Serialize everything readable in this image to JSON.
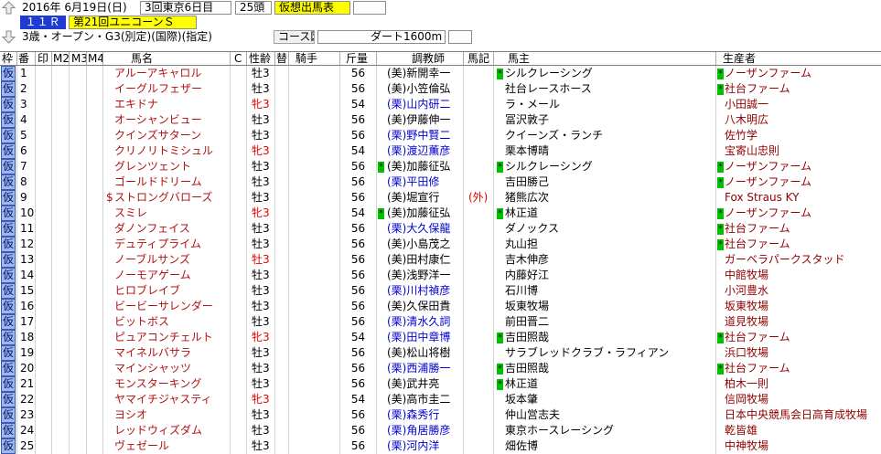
{
  "toolbar": {
    "date": "2016年 6月19日(日)",
    "meeting": "3回東京6日目",
    "runners": "25頭",
    "mode": "仮想出馬表",
    "race_number": "１１Ｒ",
    "race_name": "第21回ユニコーンＳ",
    "conditions": "3歳・オープン・G3(別定)(国際)(指定)",
    "course_map_button": "コース図",
    "course": "ダート1600m"
  },
  "icons": {
    "previous": "up-arrow-icon",
    "next": "down-arrow-icon"
  },
  "colors": {
    "text": "#000000",
    "horse_name": "#b01010",
    "female": "#e00000",
    "east_trainer": "#000000",
    "west_trainer": "#0000d0",
    "horse_mark": "#e00000",
    "breeder": "#900000",
    "marker": "#00c000",
    "waku_badge": "#9db8ec",
    "race_number_bg": "#1e3cd2",
    "highlight": "#ffff00"
  },
  "columns": [
    "枠",
    "番",
    "印",
    "M2",
    "M3",
    "M4",
    "馬名",
    "C",
    "性齢",
    "替",
    "騎手",
    "斤量",
    "調教師",
    "馬記",
    "馬主",
    "生産者"
  ],
  "rows": [
    {
      "waku": "仮",
      "no": "1",
      "name_prefix": "",
      "name": "アルーアキャロル",
      "sex_age": "牡3",
      "sex_red": false,
      "weight": "56",
      "trainer_mark": "",
      "trainer": "(美)新開幸一",
      "trainer_west": false,
      "horse_mark": "",
      "owner_mark": "*",
      "owner": "シルクレーシング",
      "breeder_mark": "*",
      "breeder": "ノーザンファーム"
    },
    {
      "waku": "仮",
      "no": "2",
      "name_prefix": "",
      "name": "イーグルフェザー",
      "sex_age": "牡3",
      "sex_red": false,
      "weight": "56",
      "trainer_mark": "",
      "trainer": "(美)小笠倫弘",
      "trainer_west": false,
      "horse_mark": "",
      "owner_mark": "",
      "owner": "社台レースホース",
      "breeder_mark": "*",
      "breeder": "社台ファーム"
    },
    {
      "waku": "仮",
      "no": "3",
      "name_prefix": "",
      "name": "エキドナ",
      "sex_age": "牝3",
      "sex_red": true,
      "weight": "54",
      "trainer_mark": "",
      "trainer": "(栗)山内研二",
      "trainer_west": true,
      "horse_mark": "",
      "owner_mark": "",
      "owner": "ラ・メール",
      "breeder_mark": "",
      "breeder": "小田誠一"
    },
    {
      "waku": "仮",
      "no": "4",
      "name_prefix": "",
      "name": "オーシャンビュー",
      "sex_age": "牡3",
      "sex_red": false,
      "weight": "56",
      "trainer_mark": "",
      "trainer": "(美)伊藤伸一",
      "trainer_west": false,
      "horse_mark": "",
      "owner_mark": "",
      "owner": "冨沢敦子",
      "breeder_mark": "",
      "breeder": "八木明広"
    },
    {
      "waku": "仮",
      "no": "5",
      "name_prefix": "",
      "name": "クインズサターン",
      "sex_age": "牡3",
      "sex_red": false,
      "weight": "56",
      "trainer_mark": "",
      "trainer": "(栗)野中賢二",
      "trainer_west": true,
      "horse_mark": "",
      "owner_mark": "",
      "owner": "クイーンズ・ランチ",
      "breeder_mark": "",
      "breeder": "佐竹学"
    },
    {
      "waku": "仮",
      "no": "6",
      "name_prefix": "",
      "name": "クリノリトミシュル",
      "sex_age": "牝3",
      "sex_red": true,
      "weight": "54",
      "trainer_mark": "",
      "trainer": "(栗)渡辺薫彦",
      "trainer_west": true,
      "horse_mark": "",
      "owner_mark": "",
      "owner": "栗本博晴",
      "breeder_mark": "",
      "breeder": "宝寄山忠則"
    },
    {
      "waku": "仮",
      "no": "7",
      "name_prefix": "",
      "name": "グレンツェント",
      "sex_age": "牡3",
      "sex_red": false,
      "weight": "56",
      "trainer_mark": "*",
      "trainer": "(美)加藤征弘",
      "trainer_west": false,
      "horse_mark": "",
      "owner_mark": "*",
      "owner": "シルクレーシング",
      "breeder_mark": "*",
      "breeder": "ノーザンファーム"
    },
    {
      "waku": "仮",
      "no": "8",
      "name_prefix": "",
      "name": "ゴールドドリーム",
      "sex_age": "牡3",
      "sex_red": false,
      "weight": "56",
      "trainer_mark": "",
      "trainer": "(栗)平田修",
      "trainer_west": true,
      "horse_mark": "",
      "owner_mark": "",
      "owner": "吉田勝己",
      "breeder_mark": "*",
      "breeder": "ノーザンファーム"
    },
    {
      "waku": "仮",
      "no": "9",
      "name_prefix": "$",
      "name": "ストロングバローズ",
      "sex_age": "牡3",
      "sex_red": false,
      "weight": "56",
      "trainer_mark": "",
      "trainer": "(美)堀宣行",
      "trainer_west": false,
      "horse_mark": "(外)",
      "owner_mark": "",
      "owner": "猪熊広次",
      "breeder_mark": "",
      "breeder": "Fox Straus KY"
    },
    {
      "waku": "仮",
      "no": "10",
      "name_prefix": "",
      "name": "スミレ",
      "sex_age": "牝3",
      "sex_red": true,
      "weight": "54",
      "trainer_mark": "*",
      "trainer": "(美)加藤征弘",
      "trainer_west": false,
      "horse_mark": "",
      "owner_mark": "*",
      "owner": "林正道",
      "breeder_mark": "*",
      "breeder": "ノーザンファーム"
    },
    {
      "waku": "仮",
      "no": "11",
      "name_prefix": "",
      "name": "ダノンフェイス",
      "sex_age": "牡3",
      "sex_red": false,
      "weight": "56",
      "trainer_mark": "",
      "trainer": "(栗)大久保龍",
      "trainer_west": true,
      "horse_mark": "",
      "owner_mark": "",
      "owner": "ダノックス",
      "breeder_mark": "*",
      "breeder": "社台ファーム"
    },
    {
      "waku": "仮",
      "no": "12",
      "name_prefix": "",
      "name": "デュティプライム",
      "sex_age": "牡3",
      "sex_red": false,
      "weight": "56",
      "trainer_mark": "",
      "trainer": "(美)小島茂之",
      "trainer_west": false,
      "horse_mark": "",
      "owner_mark": "",
      "owner": "丸山担",
      "breeder_mark": "*",
      "breeder": "社台ファーム"
    },
    {
      "waku": "仮",
      "no": "13",
      "name_prefix": "",
      "name": "ノーブルサンズ",
      "sex_age": "牡3",
      "sex_red": true,
      "weight": "56",
      "trainer_mark": "",
      "trainer": "(美)田村康仁",
      "trainer_west": false,
      "horse_mark": "",
      "owner_mark": "",
      "owner": "吉木伸彦",
      "breeder_mark": "",
      "breeder": "ガーベラパークスタッド"
    },
    {
      "waku": "仮",
      "no": "14",
      "name_prefix": "",
      "name": "ノーモアゲーム",
      "sex_age": "牡3",
      "sex_red": false,
      "weight": "56",
      "trainer_mark": "",
      "trainer": "(美)浅野洋一",
      "trainer_west": false,
      "horse_mark": "",
      "owner_mark": "",
      "owner": "内藤好江",
      "breeder_mark": "",
      "breeder": "中館牧場"
    },
    {
      "waku": "仮",
      "no": "15",
      "name_prefix": "",
      "name": "ヒロブレイブ",
      "sex_age": "牡3",
      "sex_red": false,
      "weight": "56",
      "trainer_mark": "",
      "trainer": "(栗)川村禎彦",
      "trainer_west": true,
      "horse_mark": "",
      "owner_mark": "",
      "owner": "石川博",
      "breeder_mark": "",
      "breeder": "小河豊水"
    },
    {
      "waku": "仮",
      "no": "16",
      "name_prefix": "",
      "name": "ビービーサレンダー",
      "sex_age": "牡3",
      "sex_red": false,
      "weight": "56",
      "trainer_mark": "",
      "trainer": "(美)久保田貴",
      "trainer_west": false,
      "horse_mark": "",
      "owner_mark": "",
      "owner": "坂東牧場",
      "breeder_mark": "",
      "breeder": "坂東牧場"
    },
    {
      "waku": "仮",
      "no": "17",
      "name_prefix": "",
      "name": "ビットボス",
      "sex_age": "牡3",
      "sex_red": false,
      "weight": "56",
      "trainer_mark": "",
      "trainer": "(栗)清水久詞",
      "trainer_west": true,
      "horse_mark": "",
      "owner_mark": "",
      "owner": "前田晋二",
      "breeder_mark": "",
      "breeder": "道見牧場"
    },
    {
      "waku": "仮",
      "no": "18",
      "name_prefix": "",
      "name": "ピュアコンチェルト",
      "sex_age": "牝3",
      "sex_red": true,
      "weight": "54",
      "trainer_mark": "",
      "trainer": "(栗)田中章博",
      "trainer_west": true,
      "horse_mark": "",
      "owner_mark": "*",
      "owner": "吉田照哉",
      "breeder_mark": "*",
      "breeder": "社台ファーム"
    },
    {
      "waku": "仮",
      "no": "19",
      "name_prefix": "",
      "name": "マイネルバサラ",
      "sex_age": "牡3",
      "sex_red": false,
      "weight": "56",
      "trainer_mark": "",
      "trainer": "(美)松山将樹",
      "trainer_west": false,
      "horse_mark": "",
      "owner_mark": "",
      "owner": "サラブレッドクラブ・ラフィアン",
      "breeder_mark": "",
      "breeder": "浜口牧場"
    },
    {
      "waku": "仮",
      "no": "20",
      "name_prefix": "",
      "name": "マインシャッツ",
      "sex_age": "牡3",
      "sex_red": false,
      "weight": "56",
      "trainer_mark": "",
      "trainer": "(栗)西浦勝一",
      "trainer_west": true,
      "horse_mark": "",
      "owner_mark": "*",
      "owner": "吉田照哉",
      "breeder_mark": "*",
      "breeder": "社台ファーム"
    },
    {
      "waku": "仮",
      "no": "21",
      "name_prefix": "",
      "name": "モンスターキング",
      "sex_age": "牡3",
      "sex_red": false,
      "weight": "56",
      "trainer_mark": "",
      "trainer": "(美)武井亮",
      "trainer_west": false,
      "horse_mark": "",
      "owner_mark": "*",
      "owner": "林正道",
      "breeder_mark": "",
      "breeder": "柏木一則"
    },
    {
      "waku": "仮",
      "no": "22",
      "name_prefix": "",
      "name": "ヤマイチジャスティ",
      "sex_age": "牝3",
      "sex_red": true,
      "weight": "54",
      "trainer_mark": "",
      "trainer": "(美)高市圭二",
      "trainer_west": false,
      "horse_mark": "",
      "owner_mark": "",
      "owner": "坂本肇",
      "breeder_mark": "",
      "breeder": "信岡牧場"
    },
    {
      "waku": "仮",
      "no": "23",
      "name_prefix": "",
      "name": "ヨシオ",
      "sex_age": "牡3",
      "sex_red": false,
      "weight": "56",
      "trainer_mark": "",
      "trainer": "(栗)森秀行",
      "trainer_west": true,
      "horse_mark": "",
      "owner_mark": "",
      "owner": "仲山営志夫",
      "breeder_mark": "",
      "breeder": "日本中央競馬会日高育成牧場"
    },
    {
      "waku": "仮",
      "no": "24",
      "name_prefix": "",
      "name": "レッドウィズダム",
      "sex_age": "牡3",
      "sex_red": false,
      "weight": "56",
      "trainer_mark": "",
      "trainer": "(栗)角居勝彦",
      "trainer_west": true,
      "horse_mark": "",
      "owner_mark": "",
      "owner": "東京ホースレーシング",
      "breeder_mark": "",
      "breeder": "乾皆雄"
    },
    {
      "waku": "仮",
      "no": "25",
      "name_prefix": "",
      "name": "ヴェゼール",
      "sex_age": "牡3",
      "sex_red": false,
      "weight": "56",
      "trainer_mark": "",
      "trainer": "(栗)河内洋",
      "trainer_west": true,
      "horse_mark": "",
      "owner_mark": "",
      "owner": "畑佐博",
      "breeder_mark": "",
      "breeder": "中神牧場"
    }
  ]
}
